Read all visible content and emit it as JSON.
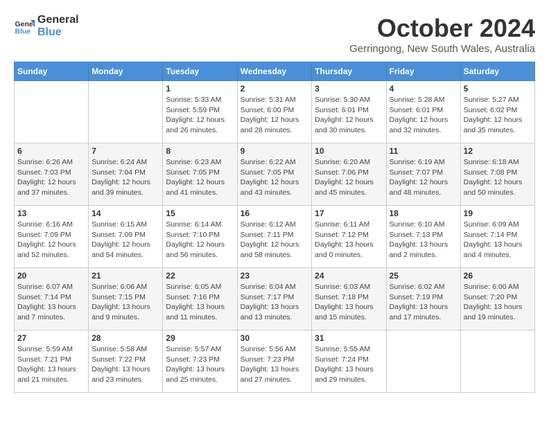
{
  "header": {
    "logo_line1": "General",
    "logo_line2": "Blue",
    "month": "October 2024",
    "location": "Gerringong, New South Wales, Australia"
  },
  "weekdays": [
    "Sunday",
    "Monday",
    "Tuesday",
    "Wednesday",
    "Thursday",
    "Friday",
    "Saturday"
  ],
  "weeks": [
    [
      {
        "day": "",
        "info": ""
      },
      {
        "day": "",
        "info": ""
      },
      {
        "day": "1",
        "info": "Sunrise: 5:33 AM\nSunset: 5:59 PM\nDaylight: 12 hours\nand 26 minutes."
      },
      {
        "day": "2",
        "info": "Sunrise: 5:31 AM\nSunset: 6:00 PM\nDaylight: 12 hours\nand 28 minutes."
      },
      {
        "day": "3",
        "info": "Sunrise: 5:30 AM\nSunset: 6:01 PM\nDaylight: 12 hours\nand 30 minutes."
      },
      {
        "day": "4",
        "info": "Sunrise: 5:28 AM\nSunset: 6:01 PM\nDaylight: 12 hours\nand 32 minutes."
      },
      {
        "day": "5",
        "info": "Sunrise: 5:27 AM\nSunset: 6:02 PM\nDaylight: 12 hours\nand 35 minutes."
      }
    ],
    [
      {
        "day": "6",
        "info": "Sunrise: 6:26 AM\nSunset: 7:03 PM\nDaylight: 12 hours\nand 37 minutes."
      },
      {
        "day": "7",
        "info": "Sunrise: 6:24 AM\nSunset: 7:04 PM\nDaylight: 12 hours\nand 39 minutes."
      },
      {
        "day": "8",
        "info": "Sunrise: 6:23 AM\nSunset: 7:05 PM\nDaylight: 12 hours\nand 41 minutes."
      },
      {
        "day": "9",
        "info": "Sunrise: 6:22 AM\nSunset: 7:05 PM\nDaylight: 12 hours\nand 43 minutes."
      },
      {
        "day": "10",
        "info": "Sunrise: 6:20 AM\nSunset: 7:06 PM\nDaylight: 12 hours\nand 45 minutes."
      },
      {
        "day": "11",
        "info": "Sunrise: 6:19 AM\nSunset: 7:07 PM\nDaylight: 12 hours\nand 48 minutes."
      },
      {
        "day": "12",
        "info": "Sunrise: 6:18 AM\nSunset: 7:08 PM\nDaylight: 12 hours\nand 50 minutes."
      }
    ],
    [
      {
        "day": "13",
        "info": "Sunrise: 6:16 AM\nSunset: 7:09 PM\nDaylight: 12 hours\nand 52 minutes."
      },
      {
        "day": "14",
        "info": "Sunrise: 6:15 AM\nSunset: 7:09 PM\nDaylight: 12 hours\nand 54 minutes."
      },
      {
        "day": "15",
        "info": "Sunrise: 6:14 AM\nSunset: 7:10 PM\nDaylight: 12 hours\nand 56 minutes."
      },
      {
        "day": "16",
        "info": "Sunrise: 6:12 AM\nSunset: 7:11 PM\nDaylight: 12 hours\nand 58 minutes."
      },
      {
        "day": "17",
        "info": "Sunrise: 6:11 AM\nSunset: 7:12 PM\nDaylight: 13 hours\nand 0 minutes."
      },
      {
        "day": "18",
        "info": "Sunrise: 6:10 AM\nSunset: 7:13 PM\nDaylight: 13 hours\nand 2 minutes."
      },
      {
        "day": "19",
        "info": "Sunrise: 6:09 AM\nSunset: 7:14 PM\nDaylight: 13 hours\nand 4 minutes."
      }
    ],
    [
      {
        "day": "20",
        "info": "Sunrise: 6:07 AM\nSunset: 7:14 PM\nDaylight: 13 hours\nand 7 minutes."
      },
      {
        "day": "21",
        "info": "Sunrise: 6:06 AM\nSunset: 7:15 PM\nDaylight: 13 hours\nand 9 minutes."
      },
      {
        "day": "22",
        "info": "Sunrise: 6:05 AM\nSunset: 7:16 PM\nDaylight: 13 hours\nand 11 minutes."
      },
      {
        "day": "23",
        "info": "Sunrise: 6:04 AM\nSunset: 7:17 PM\nDaylight: 13 hours\nand 13 minutes."
      },
      {
        "day": "24",
        "info": "Sunrise: 6:03 AM\nSunset: 7:18 PM\nDaylight: 13 hours\nand 15 minutes."
      },
      {
        "day": "25",
        "info": "Sunrise: 6:02 AM\nSunset: 7:19 PM\nDaylight: 13 hours\nand 17 minutes."
      },
      {
        "day": "26",
        "info": "Sunrise: 6:00 AM\nSunset: 7:20 PM\nDaylight: 13 hours\nand 19 minutes."
      }
    ],
    [
      {
        "day": "27",
        "info": "Sunrise: 5:59 AM\nSunset: 7:21 PM\nDaylight: 13 hours\nand 21 minutes."
      },
      {
        "day": "28",
        "info": "Sunrise: 5:58 AM\nSunset: 7:22 PM\nDaylight: 13 hours\nand 23 minutes."
      },
      {
        "day": "29",
        "info": "Sunrise: 5:57 AM\nSunset: 7:23 PM\nDaylight: 13 hours\nand 25 minutes."
      },
      {
        "day": "30",
        "info": "Sunrise: 5:56 AM\nSunset: 7:23 PM\nDaylight: 13 hours\nand 27 minutes."
      },
      {
        "day": "31",
        "info": "Sunrise: 5:55 AM\nSunset: 7:24 PM\nDaylight: 13 hours\nand 29 minutes."
      },
      {
        "day": "",
        "info": ""
      },
      {
        "day": "",
        "info": ""
      }
    ]
  ]
}
